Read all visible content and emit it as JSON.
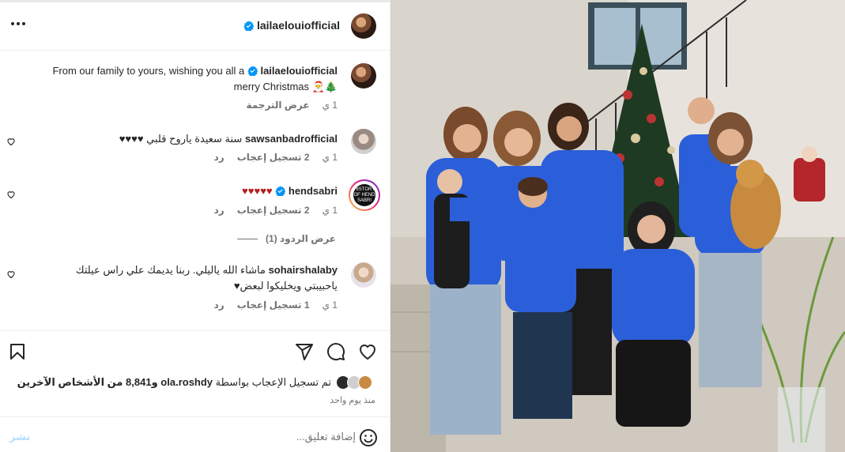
{
  "header": {
    "username": "lailaelouiofficial"
  },
  "caption": {
    "username": "lailaelouiofficial",
    "text_line1": "From our family to yours, wishing you all a",
    "text_line2": "merry Christmas 🎅🎄",
    "time": "1 ي",
    "see_translation": "عرض الترجمة"
  },
  "comments": [
    {
      "username": "sawsanbadrofficial",
      "text": "سنة سعيدة ياروح قلبي ♥♥♥♥",
      "time": "1 ي",
      "likes": "2 تسجيل إعجاب",
      "reply": "رد"
    },
    {
      "username": "hendsabri",
      "text": "♥♥♥♥♥",
      "time": "1 ي",
      "likes": "2 تسجيل إعجاب",
      "reply": "رد",
      "avatar_text": "HISTORY OF HEND SABRI"
    },
    {
      "username": "sohairshalaby",
      "text_line1": "ماشاء الله ياليلي. ربنا يديمك علي راس عيلتك",
      "text_line2": "ياحبيبتي ويخليكوا لبعض♥",
      "time": "1 ي",
      "likes": "1 تسجيل إعجاب",
      "reply": "رد"
    }
  ],
  "view_replies": "عرض الردود (1)",
  "likes": {
    "prefix": "تم تسجيل الإعجاب بواسطة",
    "user": "ola.roshdy",
    "suffix": "و8,841 من الأشخاص الآخرين"
  },
  "posted_ago": "منذ يوم واحد",
  "composer": {
    "placeholder": "إضافة تعليق...",
    "post_label": "نشر"
  },
  "colors": {
    "verified": "#0095f6",
    "heart": "#b71c1c",
    "post_disabled": "#b2dffc",
    "shirt": "#2b5fd9"
  },
  "icons": [
    "more-icon",
    "verified-icon",
    "heart-icon",
    "comment-icon",
    "share-icon",
    "bookmark-icon",
    "emoji-icon"
  ]
}
